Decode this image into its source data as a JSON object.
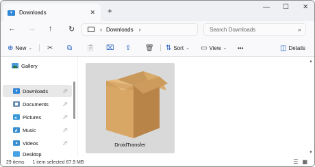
{
  "tab": {
    "title": "Downloads",
    "close": "✕",
    "new_tab": "+"
  },
  "window_controls": {
    "minimize": "—",
    "maximize": "☐",
    "close": "✕"
  },
  "nav": {
    "back": "←",
    "forward": "→",
    "up": "↑",
    "refresh": "↻"
  },
  "address": {
    "root_chevron": "›",
    "crumb": "Downloads",
    "trailing_chevron": "›"
  },
  "search": {
    "placeholder": "Search Downloads",
    "icon": "⌕"
  },
  "toolbar": {
    "new_label": "New",
    "sort_label": "Sort",
    "view_label": "View",
    "more": "•••",
    "details_label": "Details"
  },
  "sidebar": {
    "items": [
      {
        "label": "Gallery",
        "pinned": false
      },
      {
        "label": "Downloads",
        "pinned": true,
        "selected": true
      },
      {
        "label": "Documents",
        "pinned": true
      },
      {
        "label": "Pictures",
        "pinned": true
      },
      {
        "label": "Music",
        "pinned": true
      },
      {
        "label": "Videos",
        "pinned": true
      },
      {
        "label": "Desktop",
        "pinned": false
      }
    ]
  },
  "files": [
    {
      "name": "DroidTransfer",
      "selected": true
    }
  ],
  "status": {
    "count": "29 items",
    "selection": "1 item selected  67.9 MB"
  },
  "colors": {
    "accent": "#1b5bbd",
    "folder": "#f2c14e",
    "folder_blue": "#4a9be0"
  }
}
